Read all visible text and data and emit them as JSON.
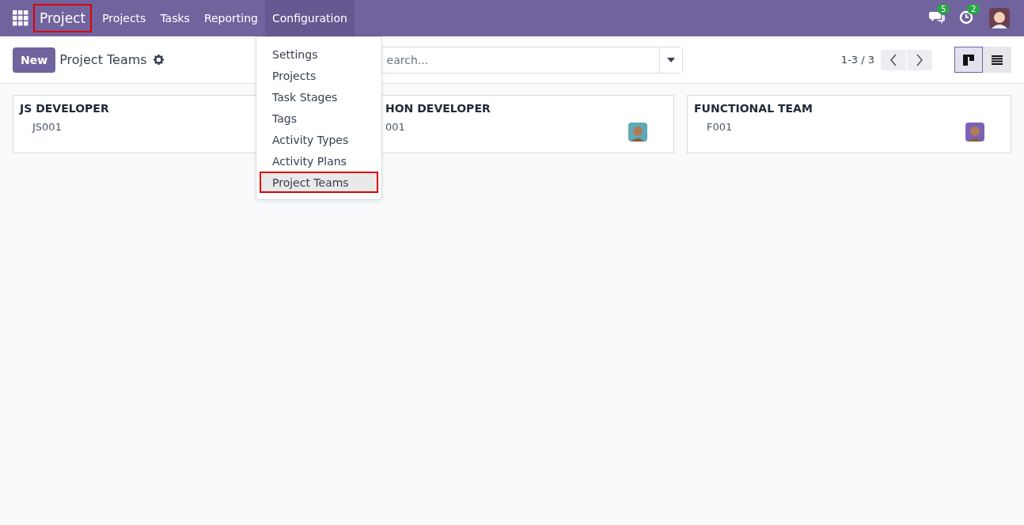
{
  "navbar": {
    "app_name": "Project",
    "app_highlighted": true,
    "menus": [
      {
        "label": "Projects",
        "open": false
      },
      {
        "label": "Tasks",
        "open": false
      },
      {
        "label": "Reporting",
        "open": false
      },
      {
        "label": "Configuration",
        "open": true
      }
    ],
    "messages_badge": "5",
    "activities_badge": "2"
  },
  "control_panel": {
    "new_button": "New",
    "title": "Project Teams",
    "search": {
      "placeholder": "earch..."
    },
    "pager": "1-3 / 3",
    "views": [
      {
        "kind": "kanban",
        "selected": true
      },
      {
        "kind": "list",
        "selected": false
      }
    ]
  },
  "dropdown": {
    "items": [
      {
        "label": "Settings",
        "selected": false,
        "highlighted": false
      },
      {
        "label": "Projects",
        "selected": false,
        "highlighted": false
      },
      {
        "label": "Task Stages",
        "selected": false,
        "highlighted": false
      },
      {
        "label": "Tags",
        "selected": false,
        "highlighted": false
      },
      {
        "label": "Activity Types",
        "selected": false,
        "highlighted": false
      },
      {
        "label": "Activity Plans",
        "selected": false,
        "highlighted": false
      },
      {
        "label": "Project Teams",
        "selected": true,
        "highlighted": true
      }
    ]
  },
  "cards": [
    {
      "title": "JS DEVELOPER",
      "code": "JS001"
    },
    {
      "title": "HON DEVELOPER",
      "code": "001",
      "color": "#5fa9b8"
    },
    {
      "title": "FUNCTIONAL TEAM",
      "code": "F001",
      "color": "#7c62b5"
    }
  ]
}
